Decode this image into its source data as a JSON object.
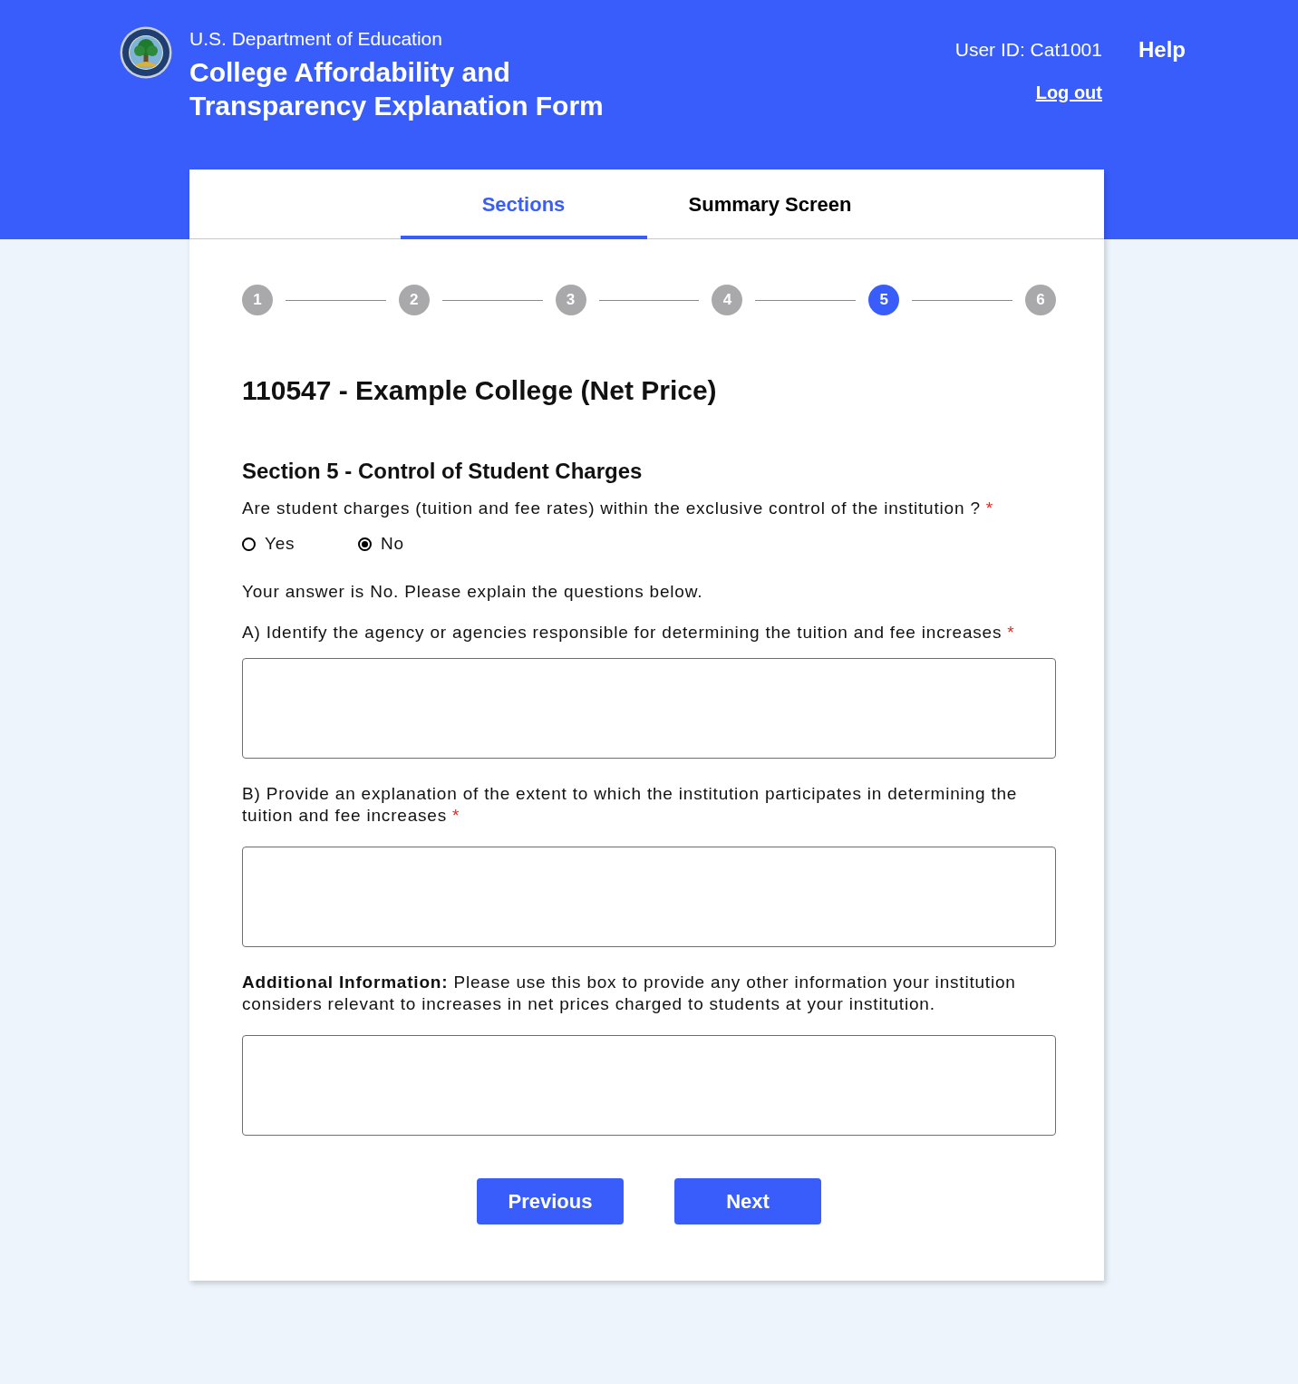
{
  "header": {
    "agency": "U.S. Department of Education",
    "title": "College Affordability and Transparency Explanation Form",
    "user_id": "User ID: Cat1001",
    "help": "Help",
    "logout": "Log out"
  },
  "tabs": [
    {
      "label": "Sections",
      "selected": true
    },
    {
      "label": "Summary Screen",
      "selected": false
    }
  ],
  "stepper": [
    {
      "label": "1",
      "selected": false
    },
    {
      "label": "2",
      "selected": false
    },
    {
      "label": "3",
      "selected": false
    },
    {
      "label": "4",
      "selected": false
    },
    {
      "label": "5",
      "selected": true
    },
    {
      "label": "6",
      "selected": false
    }
  ],
  "form": {
    "title": "110547 - Example College (Net Price)",
    "section_title": "Section 5 - Control of Student Charges",
    "question": {
      "text": "Are student charges (tuition and fee rates) within the exclusive control of the institution ?",
      "required_mark": "*",
      "options": [
        {
          "label": "Yes",
          "selected": false
        },
        {
          "label": "No",
          "selected": true
        }
      ]
    },
    "note": "Your answer is No. Please explain the questions below.",
    "fields": [
      {
        "label": "A) Identify the agency or agencies responsible for determining the tuition and fee increases",
        "required_mark": "*"
      },
      {
        "label": "B) Provide an explanation of the extent to which the institution participates in determining the tuition and fee increases",
        "required_mark": "*"
      },
      {
        "label": "**Additional Information:** Please use this box to provide any other information your institution considers relevant to increases in net prices charged to students at your institution."
      }
    ]
  },
  "buttons": [
    {
      "label": "Previous"
    },
    {
      "label": "Next"
    }
  ]
}
